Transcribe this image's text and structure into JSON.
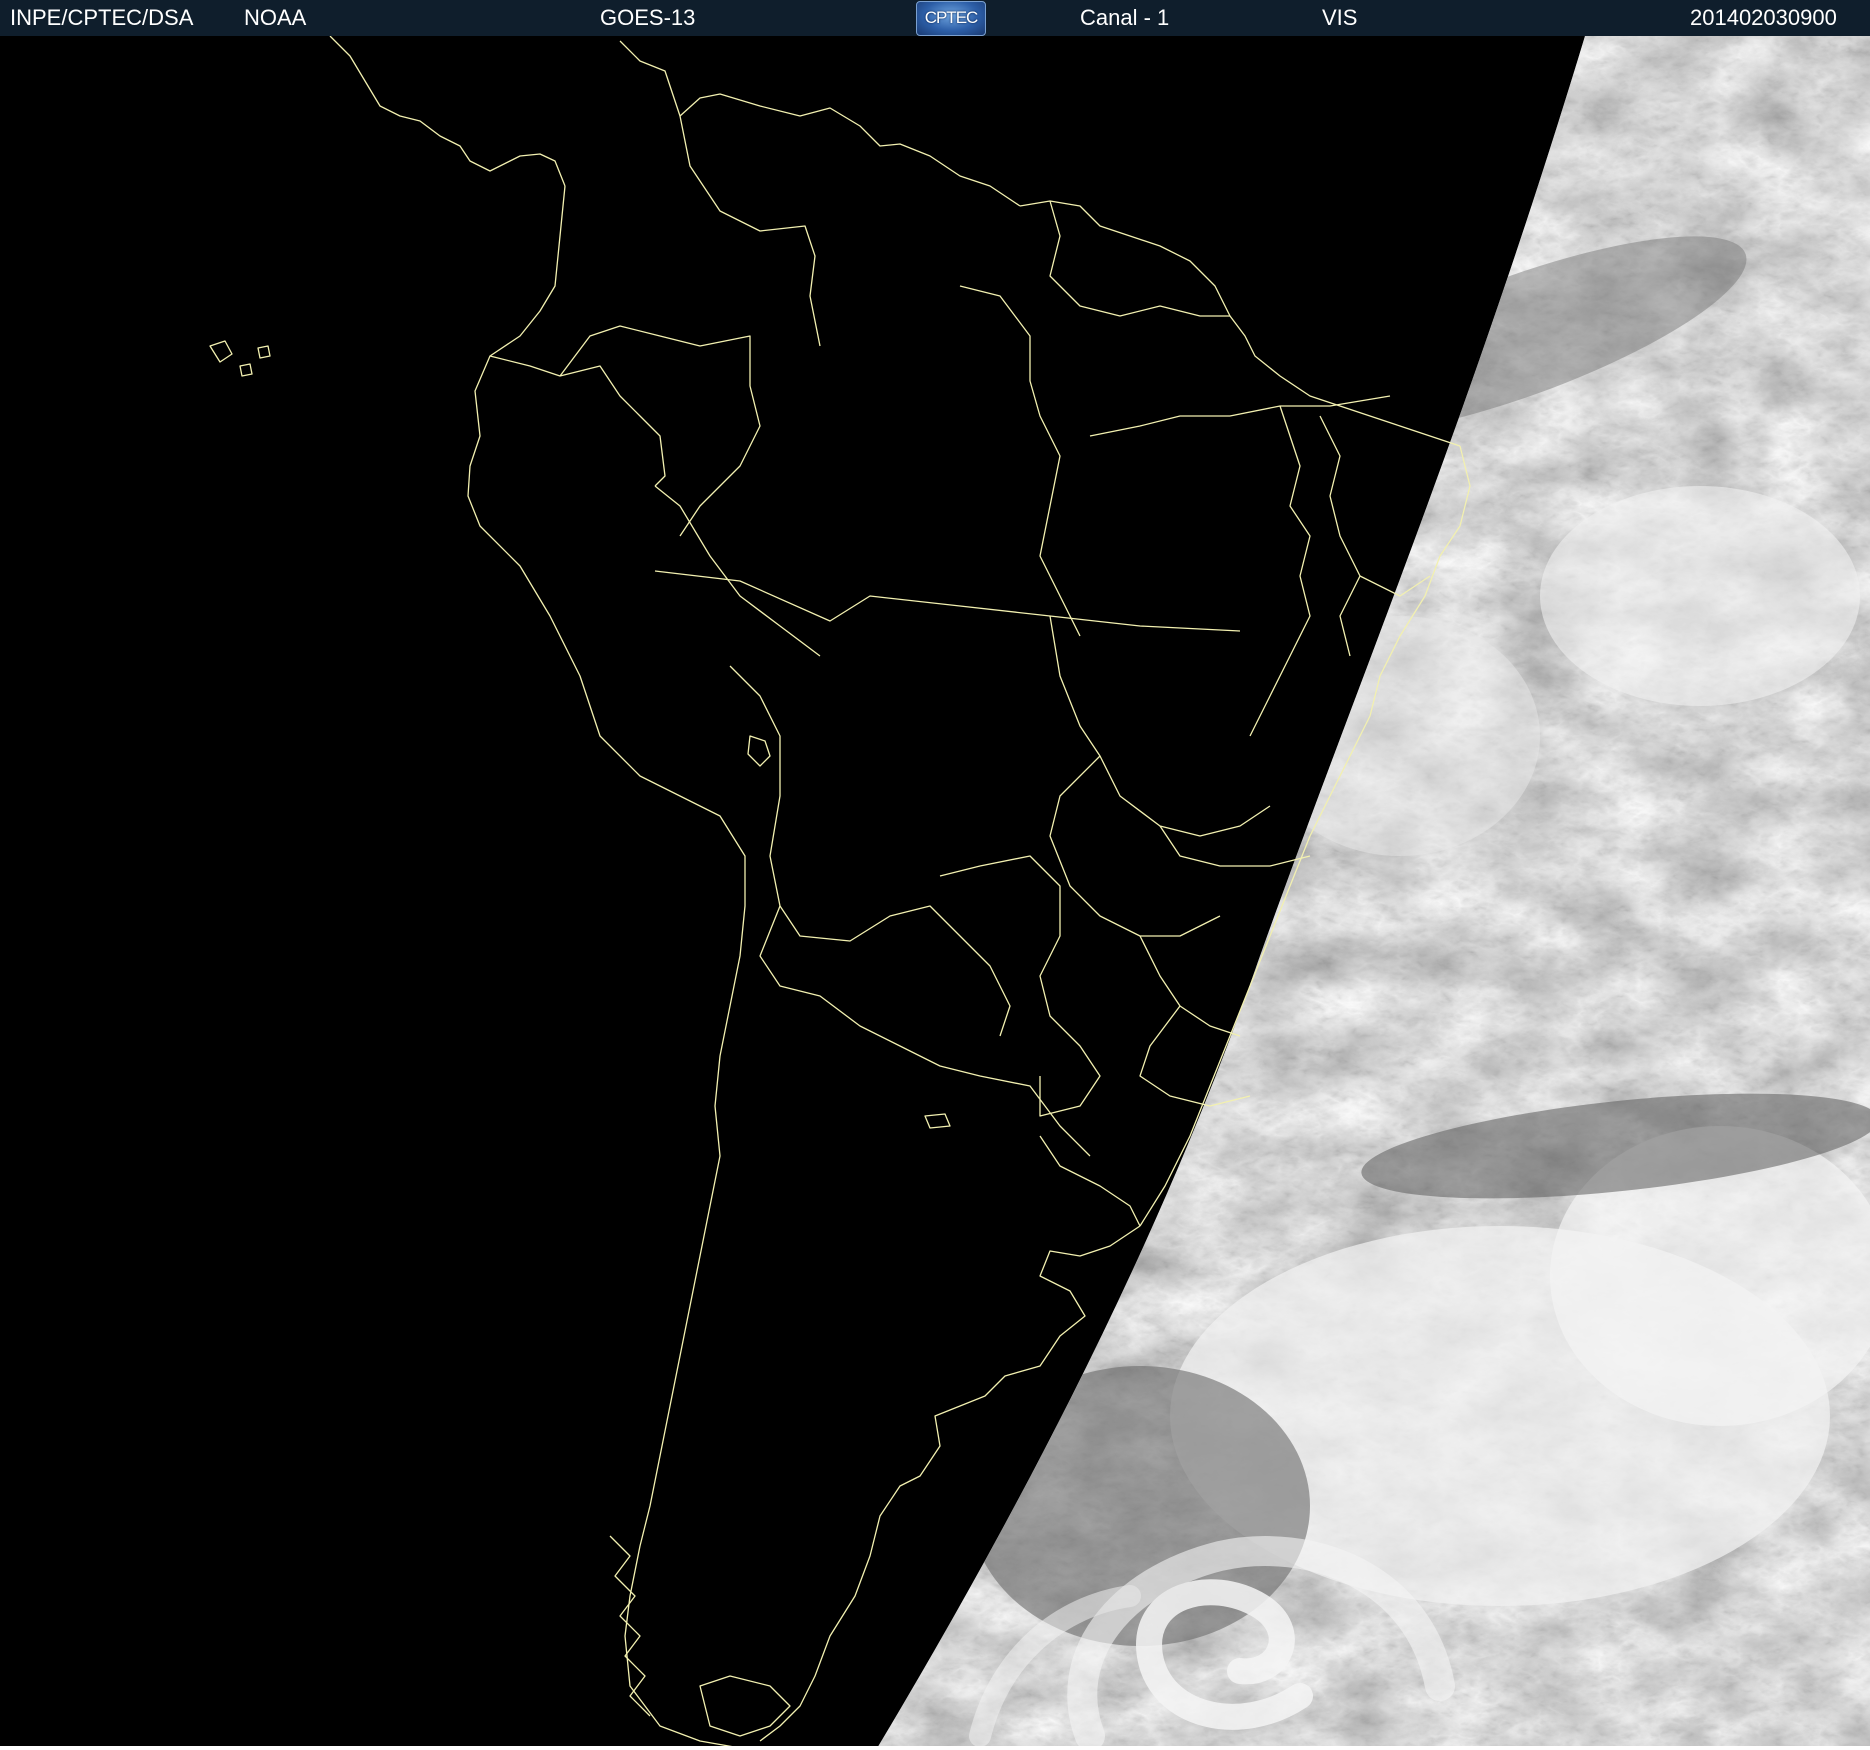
{
  "header": {
    "agency": "INPE/CPTEC/DSA",
    "source": "NOAA",
    "satellite": "GOES-13",
    "logo_text": "CPTEC",
    "channel": "Canal - 1",
    "band": "VIS",
    "timestamp": "201402030900"
  },
  "colors": {
    "header_background": "#0f1e2c",
    "header_text": "#ffffff",
    "night_side": "#000000",
    "border_lines": "#f2f0b0",
    "cloud_bright": "#f2f2f2",
    "ocean_gray": "#6e6e6e"
  },
  "map": {
    "region": "South America",
    "imagery": "visible channel satellite image, night side black, day side clouds in grayscale",
    "icons": [
      "cptec-logo"
    ]
  }
}
